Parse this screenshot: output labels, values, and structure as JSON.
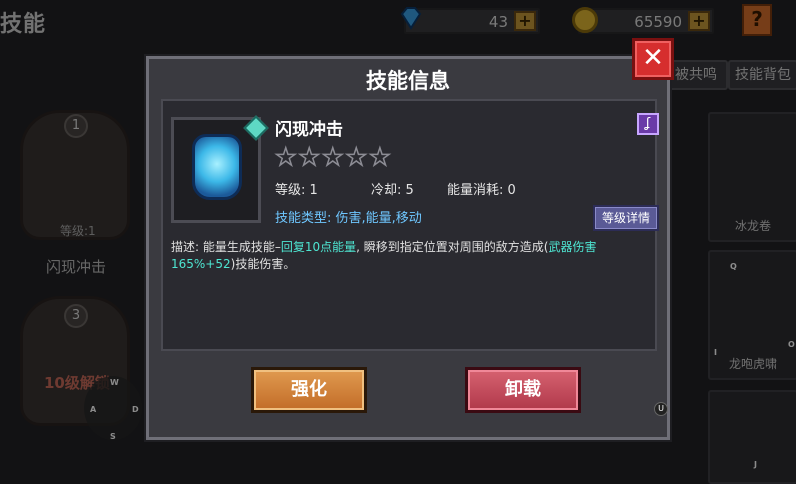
{
  "background": {
    "page_title": "技能",
    "gems": "43",
    "coins": "65590",
    "plus": "+",
    "help": "?",
    "tabs": [
      "被共鸣",
      "技能背包"
    ],
    "slots": [
      {
        "num": "1",
        "level": "等级:1",
        "name": "闪现冲击"
      },
      {
        "num": "3",
        "locked": "10级解锁"
      }
    ],
    "right_cards": [
      {
        "name": "冰龙卷"
      },
      {
        "name": "龙咆虎啸"
      }
    ],
    "keys": [
      "W",
      "A",
      "D",
      "S",
      "Q",
      "I",
      "O",
      "J",
      "U"
    ]
  },
  "modal": {
    "title": "技能信息",
    "close": "✕",
    "skill_name": "闪现冲击",
    "stars_total": 5,
    "stars_filled": 0,
    "stats": {
      "level": "等级: 1",
      "cooldown": "冷却: 5",
      "energy": "能量消耗: 0"
    },
    "type_line": "技能类型: 伤害,能量,移动",
    "level_detail": "等级详情",
    "purple_tag": "ʆ",
    "description": {
      "p1": "描述: 能量生成技能–",
      "h1": "回复10点能量",
      "p2": ", 瞬移到指定位置对周围的敌方造成(",
      "h2": "武器伤害165%+52",
      "p3": ")技能伤害。"
    },
    "enhance": "强化",
    "unload": "卸载"
  },
  "colors": {
    "close_red": "#d62e2e",
    "enhance_orange": "#d8843c",
    "unload_red": "#c44a5a",
    "highlight_cyan": "#4ee6d2",
    "type_blue": "#6fc7ff"
  }
}
